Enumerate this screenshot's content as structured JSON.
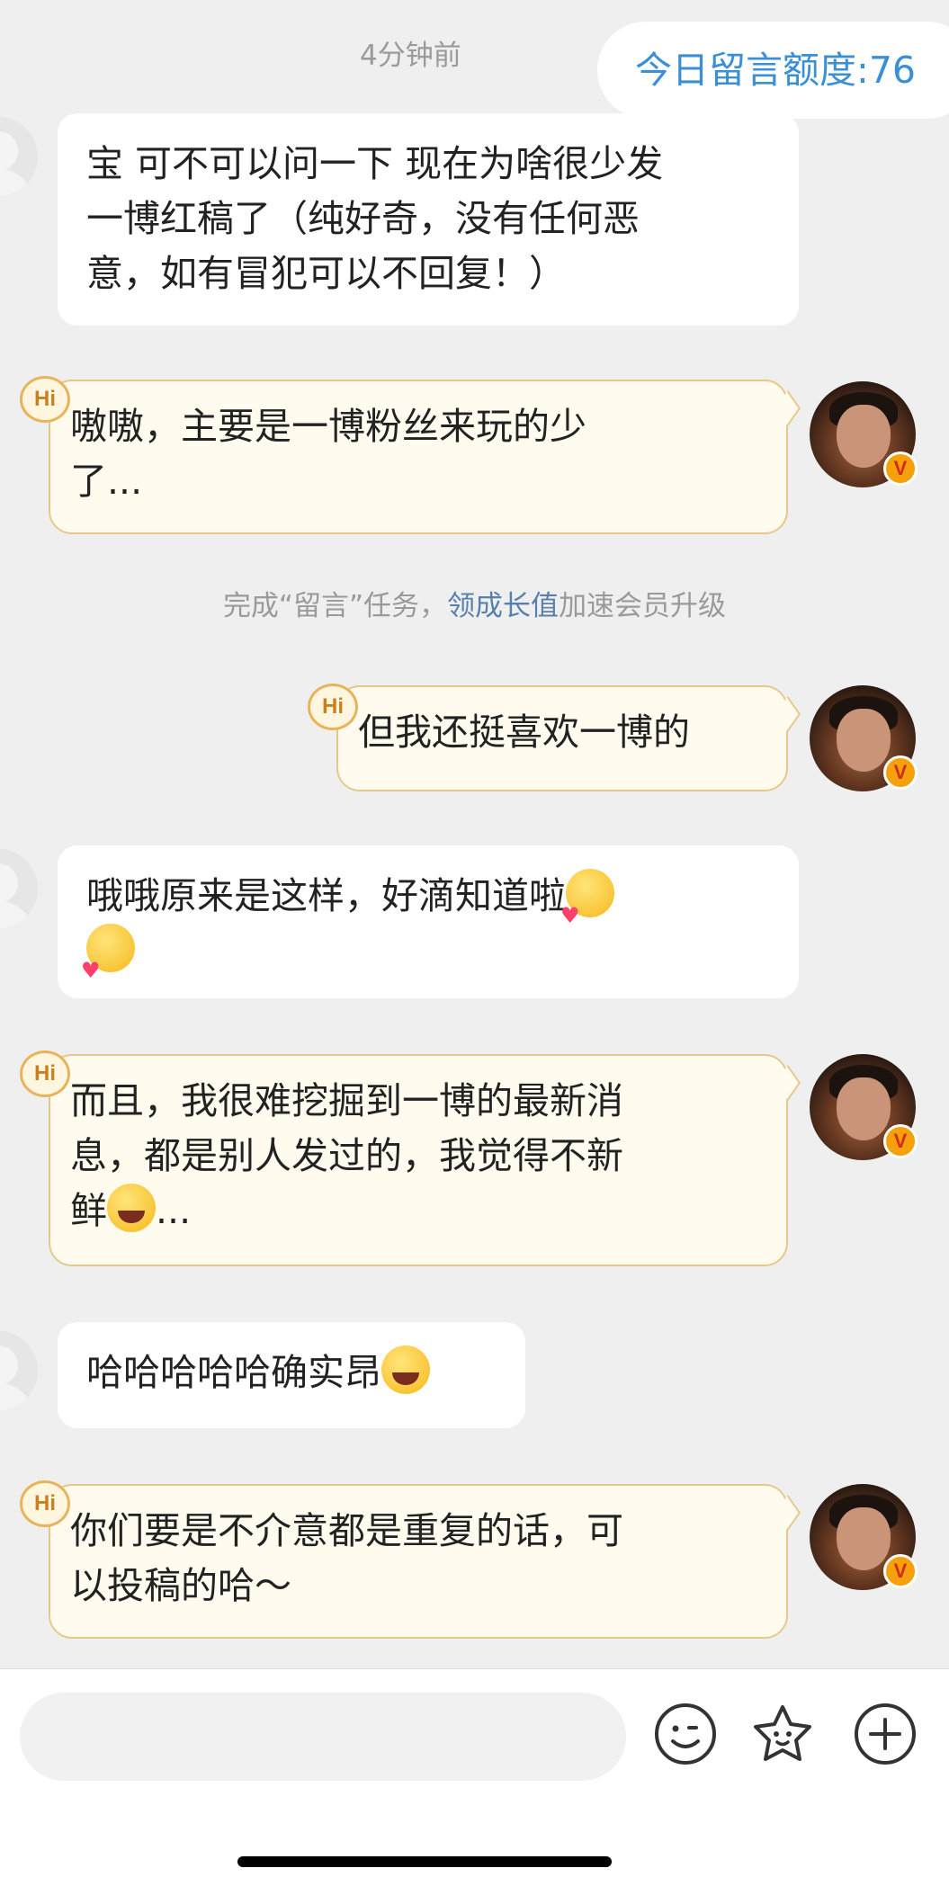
{
  "header": {
    "timestamp": "4分钟前",
    "quota_label": "今日留言额度:76"
  },
  "messages": [
    {
      "side": "in",
      "lines": [
        "宝 可不可以问一下 现在为啥很少发",
        "一博红稿了（纯好奇，没有任何恶",
        "意，如有冒犯可以不回复！）"
      ]
    },
    {
      "side": "out",
      "badge": "Hi",
      "lines": [
        "嗷嗷，主要是一博粉丝来玩的少",
        "了..."
      ]
    },
    {
      "side": "out",
      "badge": "Hi",
      "lines": [
        "但我还挺喜欢一博的"
      ]
    },
    {
      "side": "in",
      "lines": [
        "哦哦原来是这样，好滴知道啦"
      ],
      "emoji": [
        "blow-kiss",
        "blow-kiss"
      ]
    },
    {
      "side": "out",
      "badge": "Hi",
      "lines": [
        "而且，我很难挖掘到一博的最新消",
        "息，都是别人发过的，我觉得不新",
        "鲜",
        "..."
      ],
      "emoji": [
        "tears-of-joy"
      ]
    },
    {
      "side": "in",
      "lines": [
        "哈哈哈哈哈确实昂"
      ],
      "emoji": [
        "rolling-laughing"
      ]
    },
    {
      "side": "out",
      "badge": "Hi",
      "lines": [
        "你们要是不介意都是重复的话，可",
        "以投稿的哈～"
      ]
    }
  ],
  "system_note": {
    "prefix": "完成“留言”任务，",
    "link": "领成长值",
    "suffix": "加速会员升级"
  },
  "verified_badge": "V",
  "input_bar": {
    "placeholder": "",
    "icons": [
      "smile-icon",
      "star-face-icon",
      "plus-circle-icon"
    ]
  },
  "colors": {
    "background": "#efefef",
    "outgoing_bubble": "#fffbee",
    "outgoing_border": "#e8c78a",
    "link": "#5880ad",
    "quota_text": "#3a8fd6"
  }
}
